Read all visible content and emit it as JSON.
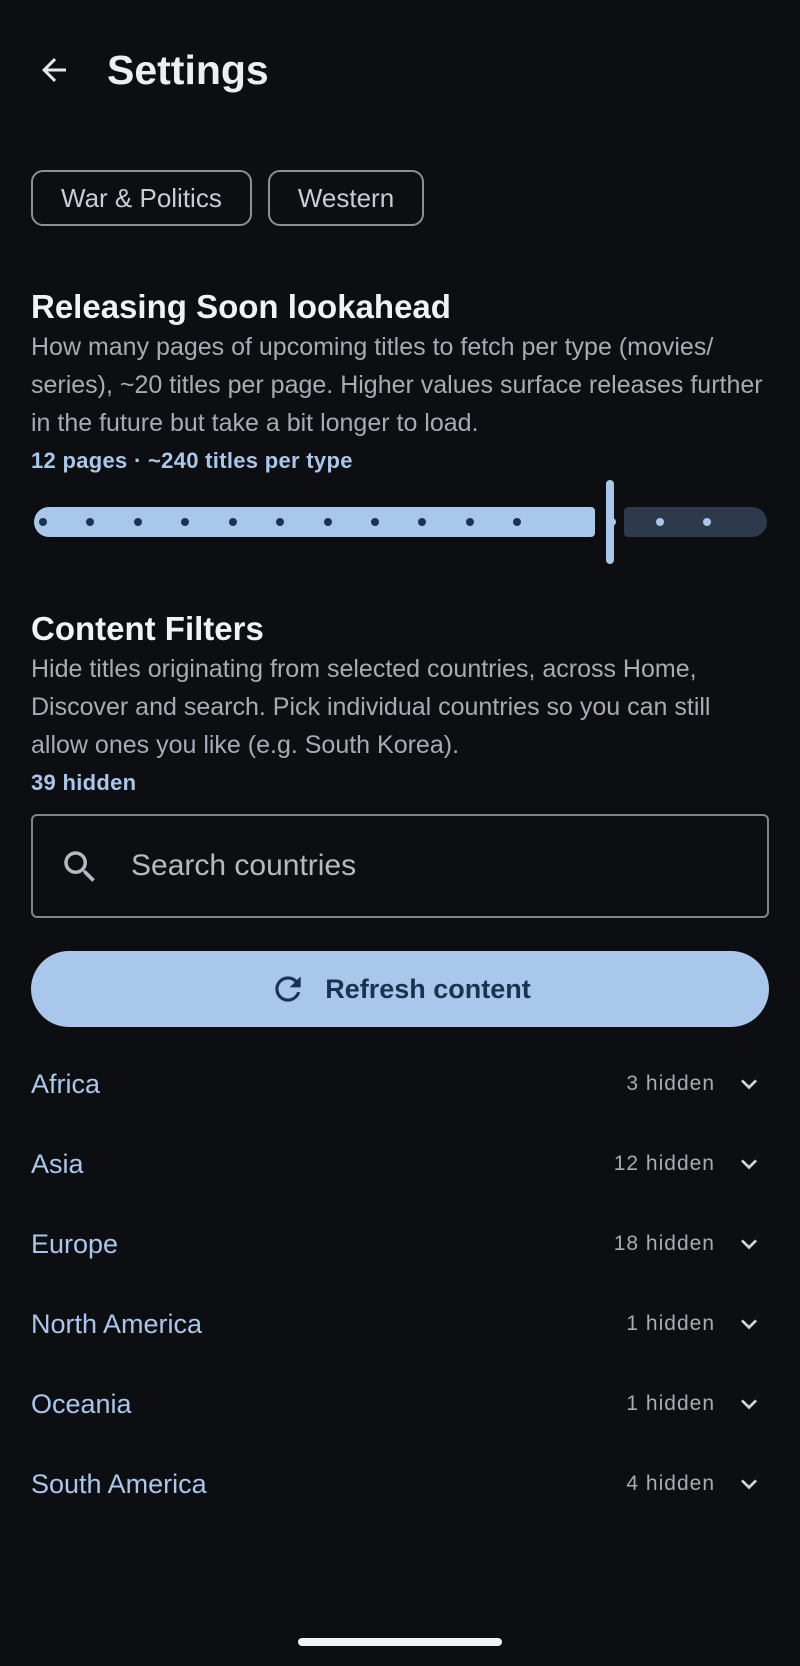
{
  "header": {
    "title": "Settings",
    "back_icon": "arrow-left-icon"
  },
  "genre_chips": [
    {
      "label": "War & Politics"
    },
    {
      "label": "Western"
    }
  ],
  "releasing_soon": {
    "title": "Releasing Soon lookahead",
    "description": "How many pages of upcoming titles to fetch per type (movies/ series), ~20 titles per page. Higher values surface releases further in the future but take a bit longer to load.",
    "summary": "12 pages · ~240 titles per type",
    "slider": {
      "value": 12,
      "min": 1,
      "max": 15
    }
  },
  "content_filters": {
    "title": "Content Filters",
    "description": "Hide titles originating from selected countries, across Home, Discover and search. Pick individual countries so you can still allow ones you like (e.g. South Korea).",
    "hidden_summary": "39 hidden",
    "search": {
      "placeholder": "Search countries",
      "icon": "search-icon"
    },
    "refresh_button": {
      "label": "Refresh content",
      "icon": "refresh-icon"
    },
    "regions": [
      {
        "name": "Africa",
        "count": "3 hidden"
      },
      {
        "name": "Asia",
        "count": "12 hidden"
      },
      {
        "name": "Europe",
        "count": "18 hidden"
      },
      {
        "name": "North America",
        "count": "1 hidden"
      },
      {
        "name": "Oceania",
        "count": "1 hidden"
      },
      {
        "name": "South America",
        "count": "4 hidden"
      }
    ]
  },
  "colors": {
    "background": "#0d0e12",
    "accent": "#a9c7ea",
    "accent_dark": "#1c3350",
    "track_inactive": "#2d3a4c",
    "text_secondary": "#a8abb3"
  }
}
